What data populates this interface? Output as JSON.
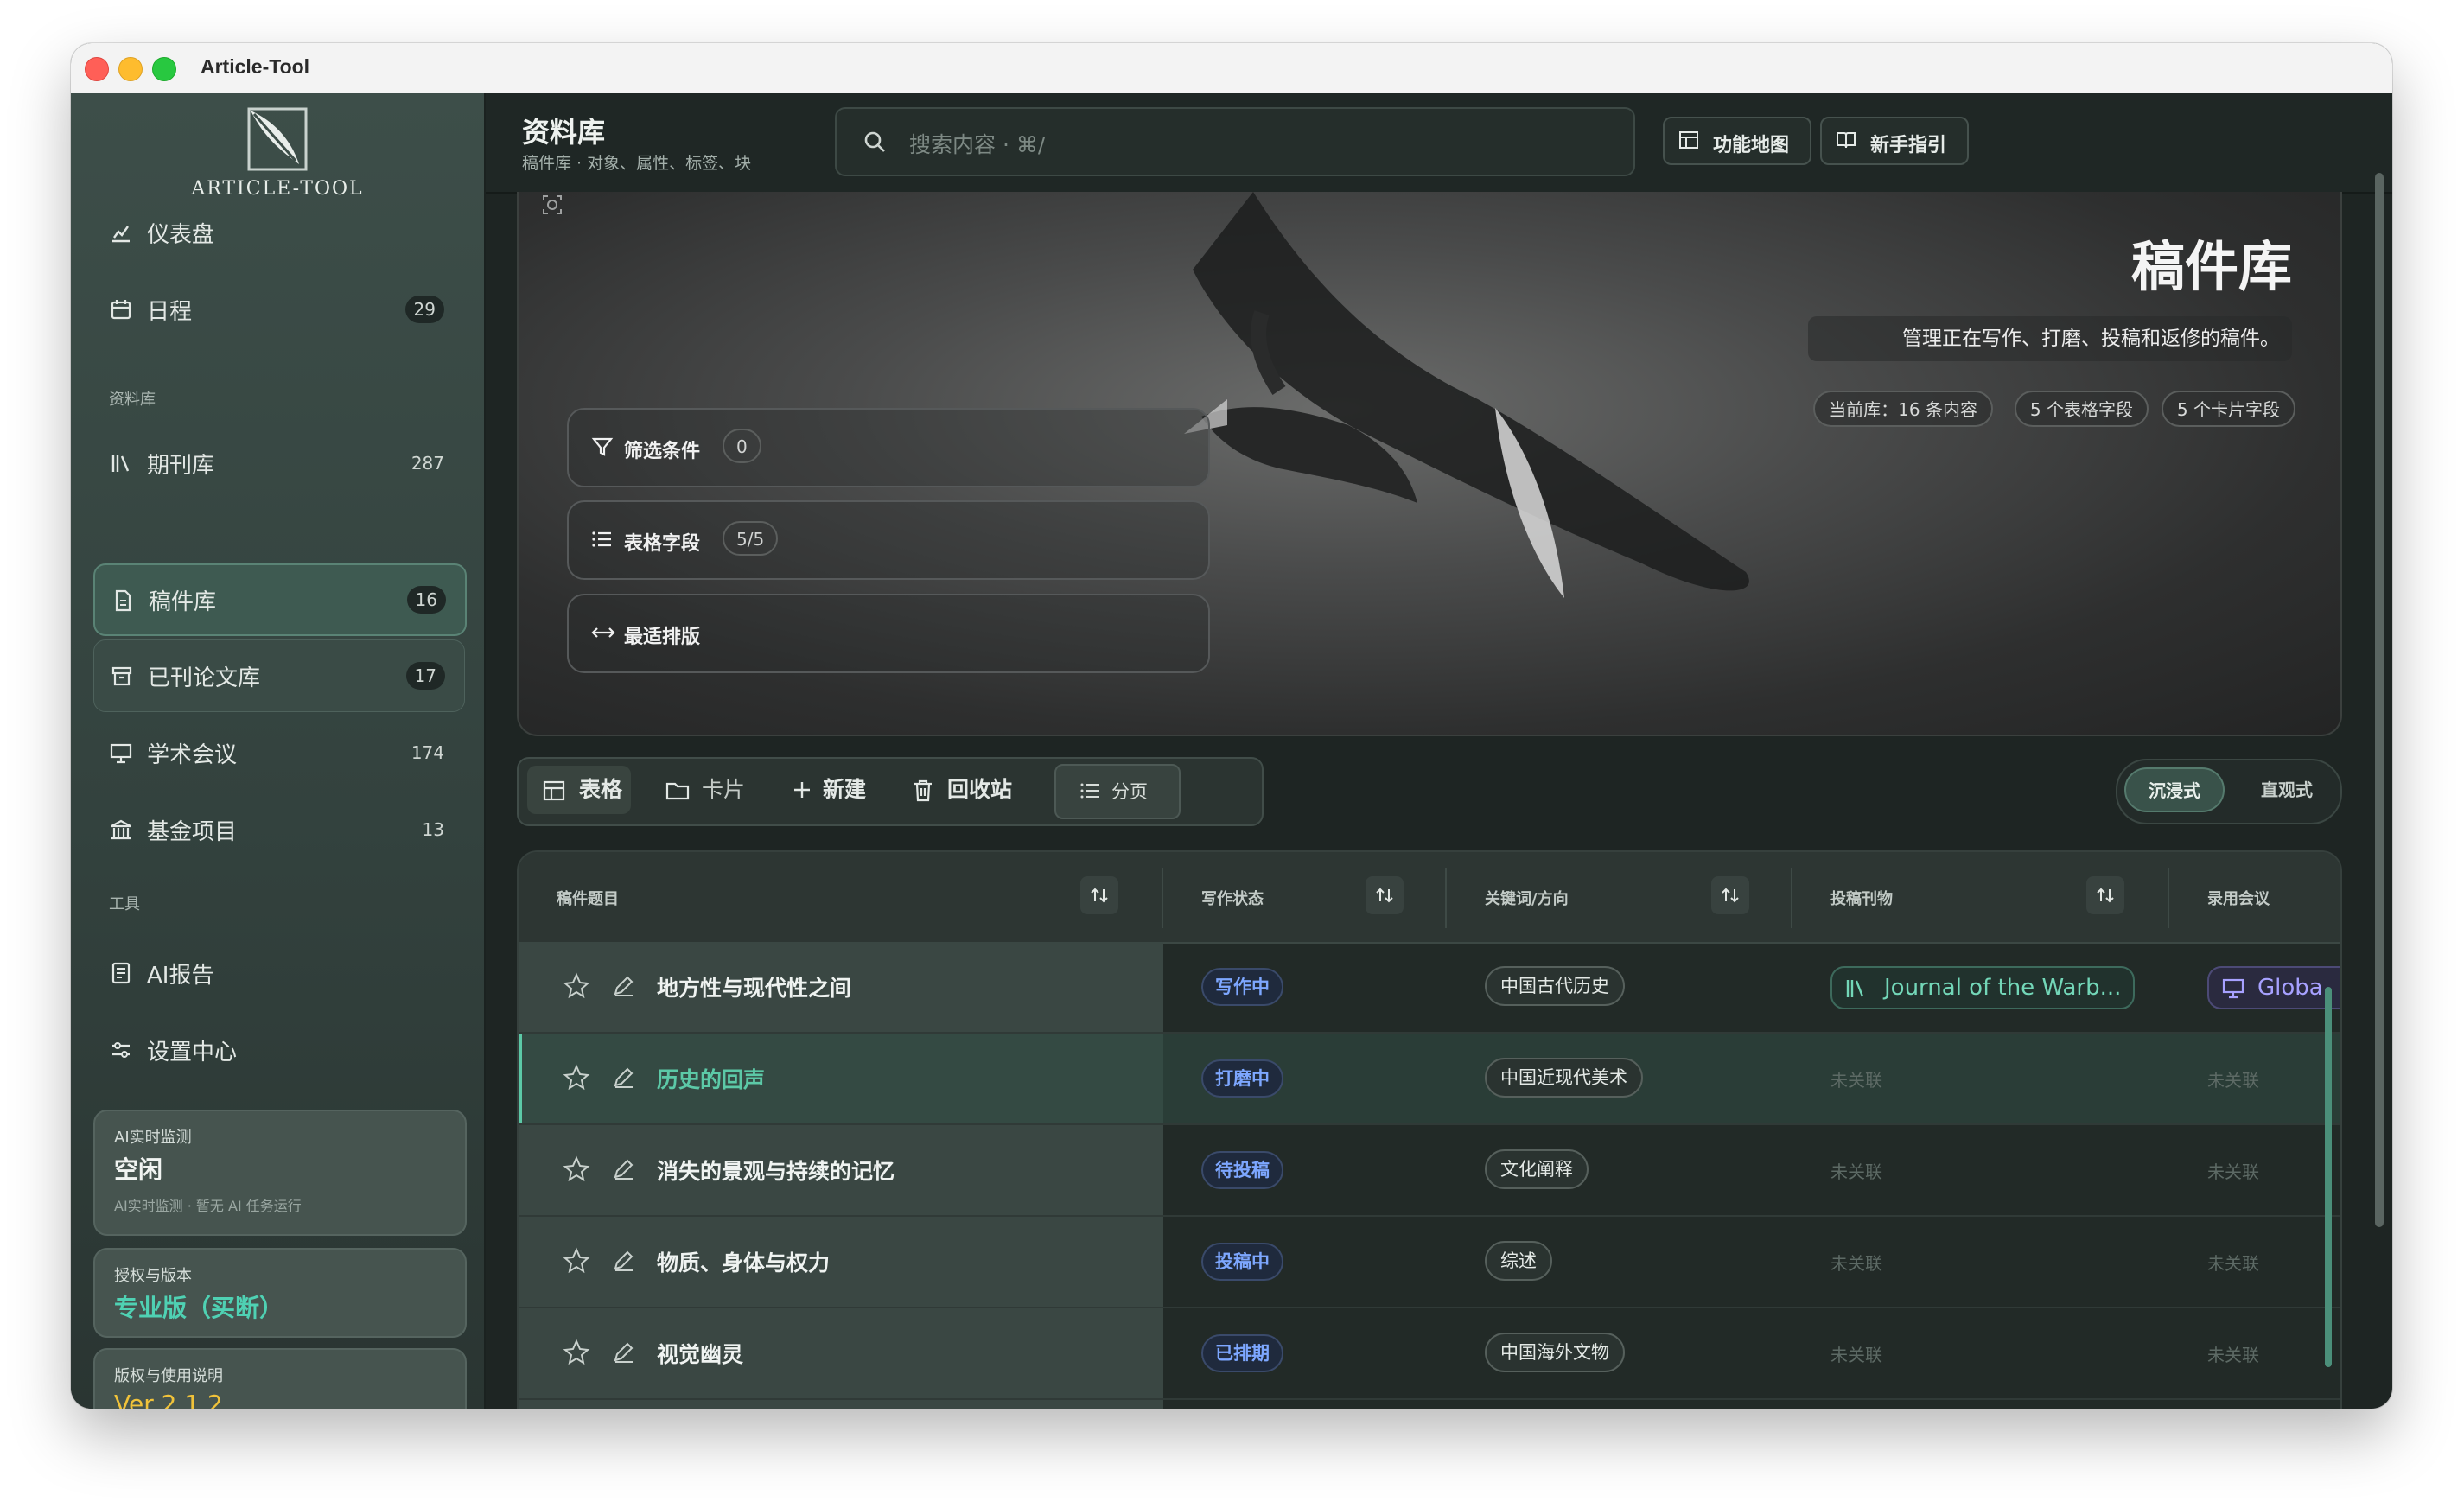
{
  "window": {
    "title": "Article-Tool"
  },
  "logo": {
    "text": "ARTICLE-TOOL"
  },
  "sidebar": {
    "items": [
      {
        "label": "仪表盘",
        "count": ""
      },
      {
        "label": "日程",
        "count": "29"
      },
      {
        "label": "期刊库",
        "count": "287"
      },
      {
        "label": "稿件库",
        "count": "16"
      },
      {
        "label": "已刊论文库",
        "count": "17"
      },
      {
        "label": "学术会议",
        "count": "174"
      },
      {
        "label": "基金项目",
        "count": "13"
      },
      {
        "label": "AI报告",
        "count": ""
      },
      {
        "label": "设置中心",
        "count": ""
      }
    ],
    "section_library": "资料库",
    "section_tools": "工具",
    "monitor": {
      "label": "AI实时监测",
      "value": "空闲",
      "sub": "AI实时监测 · 暂无 AI 任务运行"
    },
    "license": {
      "label": "授权与版本",
      "value": "专业版（买断）"
    },
    "version": {
      "label": "版权与使用说明",
      "value": "Ver 2.1.2"
    }
  },
  "header": {
    "title": "资料库",
    "subtitle": "稿件库 · 对象、属性、标签、块",
    "search_placeholder": "搜索内容 · ⌘/",
    "btn_map": "功能地图",
    "btn_guide": "新手指引"
  },
  "hero": {
    "title": "稿件库",
    "desc": "管理正在写作、打磨、投稿和返修的稿件。",
    "tags": [
      "当前库：16 条内容",
      "5 个表格字段",
      "5 个卡片字段"
    ],
    "filter_label": "筛选条件",
    "filter_count": "0",
    "fields_label": "表格字段",
    "fields_count": "5/5",
    "layout_label": "最适排版"
  },
  "toolbar": {
    "table": "表格",
    "card": "卡片",
    "new": "新建",
    "trash": "回收站",
    "paging": "分页",
    "mode_immersive": "沉浸式",
    "mode_direct": "直观式"
  },
  "table": {
    "columns": [
      "稿件题目",
      "写作状态",
      "关键词/方向",
      "投稿刊物",
      "录用会议"
    ],
    "rows": [
      {
        "title": "地方性与现代性之间",
        "status": "写作中",
        "keyword": "中国古代历史",
        "journal": "Journal of the Warb...",
        "conference": "Globa"
      },
      {
        "title": "历史的回声",
        "status": "打磨中",
        "keyword": "中国近现代美术",
        "journal": "未关联",
        "conference": "未关联"
      },
      {
        "title": "消失的景观与持续的记忆",
        "status": "待投稿",
        "keyword": "文化阐释",
        "journal": "未关联",
        "conference": "未关联"
      },
      {
        "title": "物质、身体与权力",
        "status": "投稿中",
        "keyword": "综述",
        "journal": "未关联",
        "conference": "未关联"
      },
      {
        "title": "视觉幽灵",
        "status": "已排期",
        "keyword": "中国海外文物",
        "journal": "未关联",
        "conference": "未关联"
      }
    ]
  },
  "colors": {
    "accent": "#5cc9a7",
    "status_blue": "#7da7ff",
    "license_teal": "#4fd1b3",
    "version_gold": "#f0c23a"
  }
}
